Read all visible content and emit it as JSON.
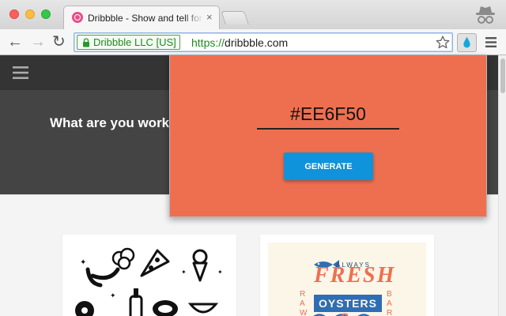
{
  "browser": {
    "tab_title": "Dribbble - Show and tell for designers",
    "tab_close": "×",
    "ev_label": "Dribbble LLC [US]",
    "url_scheme": "https://",
    "url_host": "dribbble.com",
    "back_icon": "←",
    "forward_icon": "→",
    "reload_icon": "↻"
  },
  "page": {
    "hero_heading": "What are you working on?"
  },
  "shot_b": {
    "small_text": "ALWAYS",
    "big_text": "FRESH",
    "badge_text": "OYSTERS",
    "side_left": "RAW",
    "side_right": "BAR",
    "ampersand": "&"
  },
  "popup": {
    "color_value": "#EE6F50",
    "generate_label": "GENERATE"
  },
  "colors": {
    "popup_bg": "#EE6F50",
    "button_bg": "#0F93DA",
    "ev_green": "#1F8A1F",
    "drop_blue": "#16A8DC",
    "dribbble_pink": "#EA4C89"
  }
}
